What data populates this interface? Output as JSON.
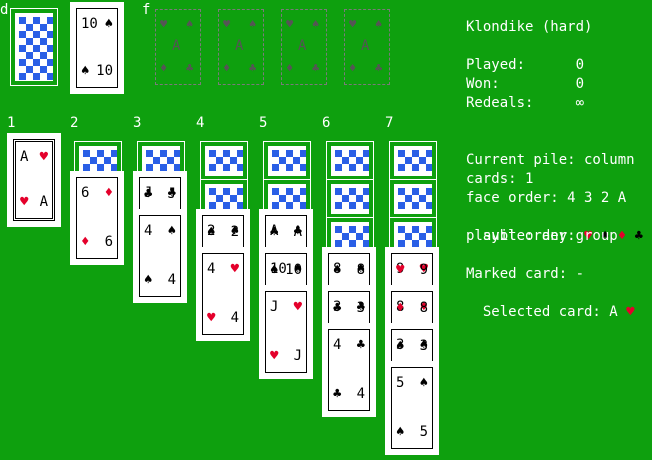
{
  "stock_label": "d",
  "found_label": "f",
  "waste_card": {
    "rank": "10",
    "suit": "♠",
    "color": "black"
  },
  "foundation_rank": "A",
  "foundation_suits": [
    "♥",
    "♠",
    "♦",
    "♣"
  ],
  "columns": [
    {
      "label": "1",
      "hidden": 0,
      "cards": [
        {
          "rank": "A",
          "suit": "♥",
          "color": "red",
          "selected": true
        }
      ]
    },
    {
      "label": "2",
      "hidden": 1,
      "cards": [
        {
          "rank": "6",
          "suit": "♦",
          "color": "red"
        }
      ]
    },
    {
      "label": "3",
      "hidden": 1,
      "cards": [
        {
          "rank": "J",
          "suit": "♣",
          "color": "black"
        },
        {
          "rank": "4",
          "suit": "♠",
          "color": "black"
        }
      ]
    },
    {
      "label": "4",
      "hidden": 2,
      "cards": [
        {
          "rank": "2",
          "suit": "♠",
          "color": "black"
        },
        {
          "rank": "4",
          "suit": "♥",
          "color": "red"
        }
      ]
    },
    {
      "label": "5",
      "hidden": 2,
      "cards": [
        {
          "rank": "A",
          "suit": "♣",
          "color": "black"
        },
        {
          "rank": "10",
          "suit": "♠",
          "color": "black"
        },
        {
          "rank": "J",
          "suit": "♥",
          "color": "red"
        }
      ]
    },
    {
      "label": "6",
      "hidden": 3,
      "cards": [
        {
          "rank": "8",
          "suit": "♠",
          "color": "black"
        },
        {
          "rank": "3",
          "suit": "♣",
          "color": "black"
        },
        {
          "rank": "4",
          "suit": "♣",
          "color": "black"
        }
      ]
    },
    {
      "label": "7",
      "hidden": 3,
      "cards": [
        {
          "rank": "9",
          "suit": "♥",
          "color": "red"
        },
        {
          "rank": "8",
          "suit": "♦",
          "color": "red"
        },
        {
          "rank": "3",
          "suit": "♠",
          "color": "black"
        },
        {
          "rank": "5",
          "suit": "♠",
          "color": "black"
        }
      ]
    }
  ],
  "info": {
    "title": "Klondike (hard)",
    "played": "Played:      0",
    "won": "Won:         0",
    "redeals": "Redeals:     ∞",
    "current_pile": "Current pile: column",
    "cards": "cards: 1",
    "face_order": "face order: 4 3 2 A",
    "suit_order_label": "suit order:",
    "suit_order": [
      {
        "suit": "♥",
        "color": "red"
      },
      {
        "suit": "♠",
        "color": "black"
      },
      {
        "suit": "♦",
        "color": "red"
      },
      {
        "suit": "♣",
        "color": "black"
      }
    ],
    "playable": "playble: any group",
    "marked": "Marked card: -",
    "selected_label": "Selected card: A",
    "selected_suit": "♥"
  },
  "colors": {
    "table": "#0ea00e",
    "red": "#e4002b",
    "back": "#2a5fe6"
  }
}
